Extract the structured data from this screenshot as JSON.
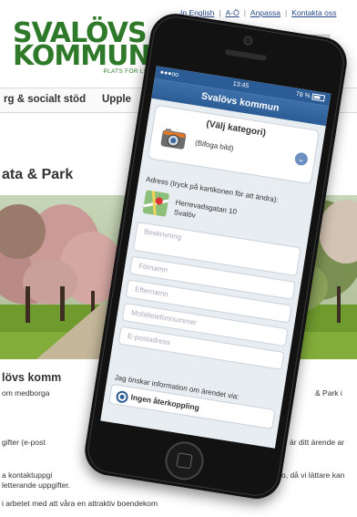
{
  "website": {
    "top_links": [
      "In English",
      "A-Ö",
      "Anpassa",
      "Kontakta oss"
    ],
    "logo": {
      "line1": "SVALÖVS",
      "line2": "KOMMUN",
      "tagline": "PLATS FÖR LIV"
    },
    "nav": [
      "rg & socialt stöd",
      "Upple"
    ],
    "page_heading": "ata & Park",
    "subheading": "lövs komm",
    "body_lines": [
      "om medborga",
      "& Park i",
      "gifter (e-post",
      "är ditt ärende ar",
      "a kontaktuppgi",
      "o, då vi lättare kan",
      "letterande uppgifter.",
      "i arbetet med att våra en attraktiv boendekom"
    ]
  },
  "phone": {
    "status": {
      "signal": "●●●oo",
      "time": "13:45",
      "battery": "78 %"
    },
    "app_title": "Svalövs kommun",
    "category_select": "(Välj kategori)",
    "attach_label": "(Bifoga bild)",
    "address_label": "Adress (tryck på kartikonen för att ändra):",
    "address_line1": "Herrevadsgatan 10",
    "address_line2": "Svalöv",
    "fields": [
      "Beskrivning",
      "Förnamn",
      "Efternamn",
      "Mobiltelefonnummer",
      "E-postadress"
    ],
    "feedback_question": "Jag önskar information om ärendet via:",
    "feedback_option": "Ingen återkoppling"
  },
  "colors": {
    "brand_green": "#2f7a2a",
    "app_blue": "#2b5c95"
  },
  "icons": [
    "camera-icon",
    "map-icon",
    "chevron-down-icon",
    "radio-selected-icon",
    "home-button-icon"
  ]
}
